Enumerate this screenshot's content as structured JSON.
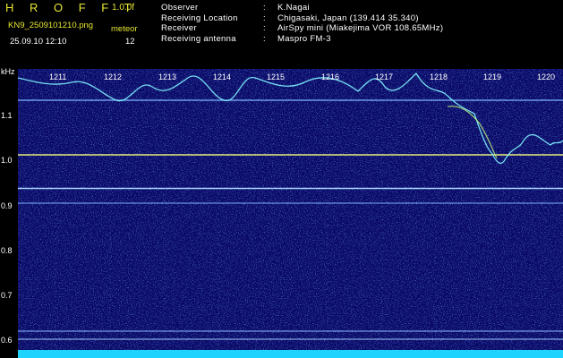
{
  "header": {
    "app_title": "H R O F F T",
    "version": "1.0.0f",
    "filename": "KN9_2509101210.png",
    "datetime": "25.09.10 12:10",
    "mode_label": "meteor",
    "mode_value": "12"
  },
  "station": [
    {
      "key": "Observer",
      "sep": ":",
      "value": "K.Nagai"
    },
    {
      "key": "Receiving Location",
      "sep": ":",
      "value": "Chigasaki, Japan (139.414 35.340)"
    },
    {
      "key": "Receiver",
      "sep": ":",
      "value": "AirSpy mini (Miakejima VOR 108.65MHz)"
    },
    {
      "key": "Receiving antenna",
      "sep": ":",
      "value": "Maspro FM-3"
    }
  ],
  "axis": {
    "unit": "kHz",
    "y_ticks": [
      "1.1",
      "1.0",
      "0.9",
      "0.8",
      "0.7",
      "0.6"
    ],
    "time_ticks": [
      "1211",
      "1212",
      "1213",
      "1214",
      "1215",
      "1216",
      "1217",
      "1218",
      "1219",
      "1220"
    ]
  },
  "colors": {
    "background": "#000000",
    "header_yellow": "#e6e632",
    "plot_blue": "#0b0b6e",
    "trace_cyan": "#7ff4ff",
    "carrier_yellow": "#e7f07a"
  }
}
